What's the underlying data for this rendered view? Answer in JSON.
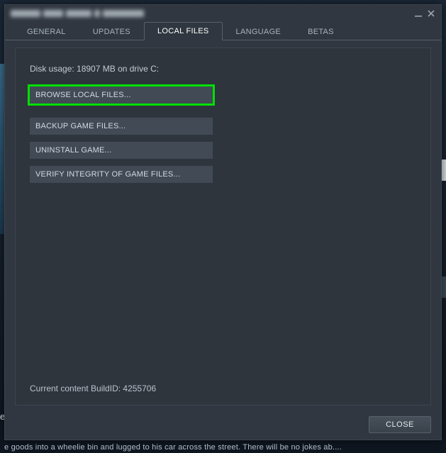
{
  "background": {
    "bottom_text": "e goods into a wheelie bin and lugged to his car across the street. There will be no jokes ab....",
    "left_snippet": "e"
  },
  "dialog": {
    "tabs": {
      "general": "GENERAL",
      "updates": "UPDATES",
      "local_files": "LOCAL FILES",
      "language": "LANGUAGE",
      "betas": "BETAS"
    },
    "local_files": {
      "disk_usage": "Disk usage: 18907 MB on drive C:",
      "browse": "BROWSE LOCAL FILES...",
      "backup": "BACKUP GAME FILES...",
      "uninstall": "UNINSTALL GAME...",
      "verify": "VERIFY INTEGRITY OF GAME FILES...",
      "build_id": "Current content BuildID: 4255706"
    },
    "footer": {
      "close": "CLOSE"
    }
  }
}
